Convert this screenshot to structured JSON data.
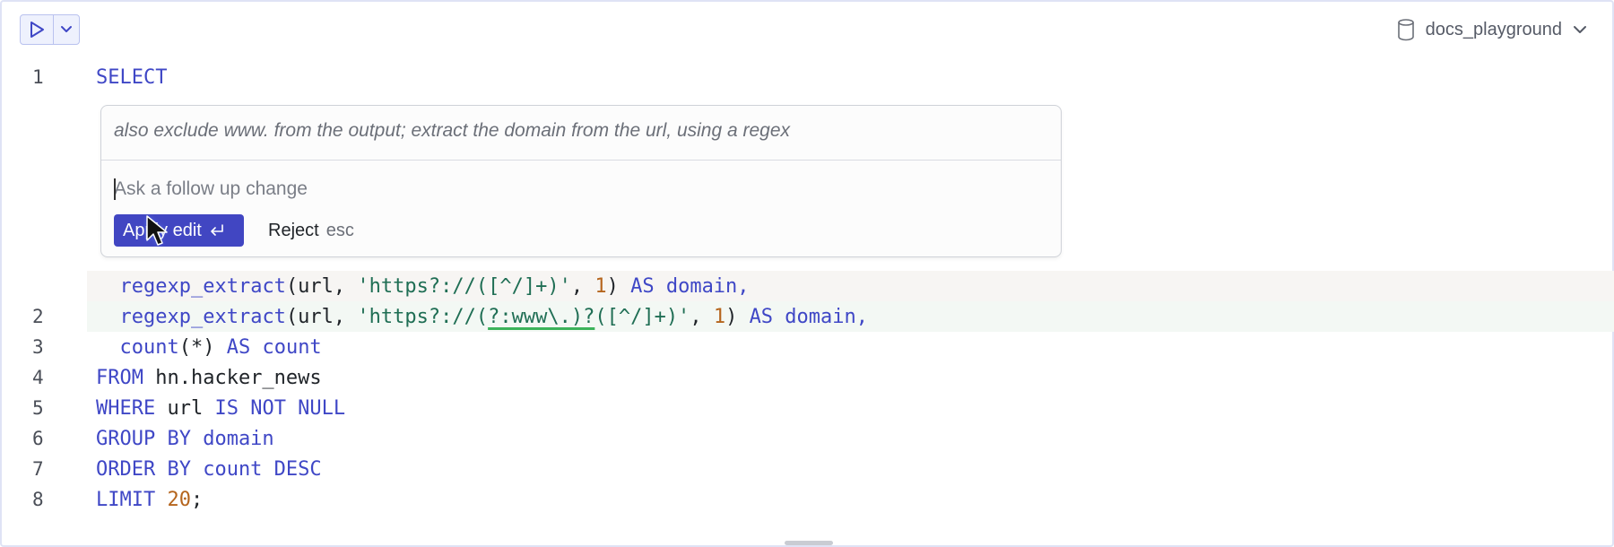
{
  "toolbar": {
    "run_icon": "play-icon",
    "run_menu_icon": "chevron-down-icon",
    "database": {
      "icon": "database-icon",
      "name": "docs_playground",
      "dropdown_icon": "chevron-down-icon"
    }
  },
  "editor": {
    "line1": {
      "number": "1",
      "keyword": "SELECT"
    },
    "removed_line": {
      "fn": "regexp_extract",
      "arg1": "(url, ",
      "string": "'https?://([^/]+)'",
      "sep": ", ",
      "num": "1",
      "close": ") ",
      "as": "AS domain,"
    },
    "line2": {
      "number": "2",
      "fn": "regexp_extract",
      "arg1": "(url, ",
      "string_a": "'https?://(",
      "string_u": "?:www\\.)?",
      "string_b": "([^/]+)'",
      "sep": ", ",
      "num": "1",
      "close": ") ",
      "as": "AS domain,"
    },
    "line3": {
      "number": "3",
      "fn": "count",
      "args": "(*) ",
      "as": "AS count"
    },
    "line4": {
      "number": "4",
      "kw": "FROM",
      "rest": " hn.hacker_news"
    },
    "line5": {
      "number": "5",
      "kw1": "WHERE",
      "mid": " url ",
      "kw2": "IS NOT NULL"
    },
    "line6": {
      "number": "6",
      "kw": "GROUP BY domain"
    },
    "line7": {
      "number": "7",
      "kw": "ORDER BY count DESC"
    },
    "line8": {
      "number": "8",
      "kw": "LIMIT ",
      "num": "20",
      "end": ";"
    }
  },
  "ai_popup": {
    "prompt": "also exclude www. from the output; extract the domain from the url, using a regex",
    "followup_placeholder": "Ask a follow up change",
    "apply_label": "Apply edit",
    "apply_shortcut_icon": "enter-key-icon",
    "reject_label": "Reject",
    "reject_shortcut": "esc"
  },
  "colors": {
    "accent": "#4146c2",
    "keyword": "#3f47c6",
    "string": "#1f6e54",
    "number": "#b5651d",
    "added_underline": "#3cb35b"
  }
}
